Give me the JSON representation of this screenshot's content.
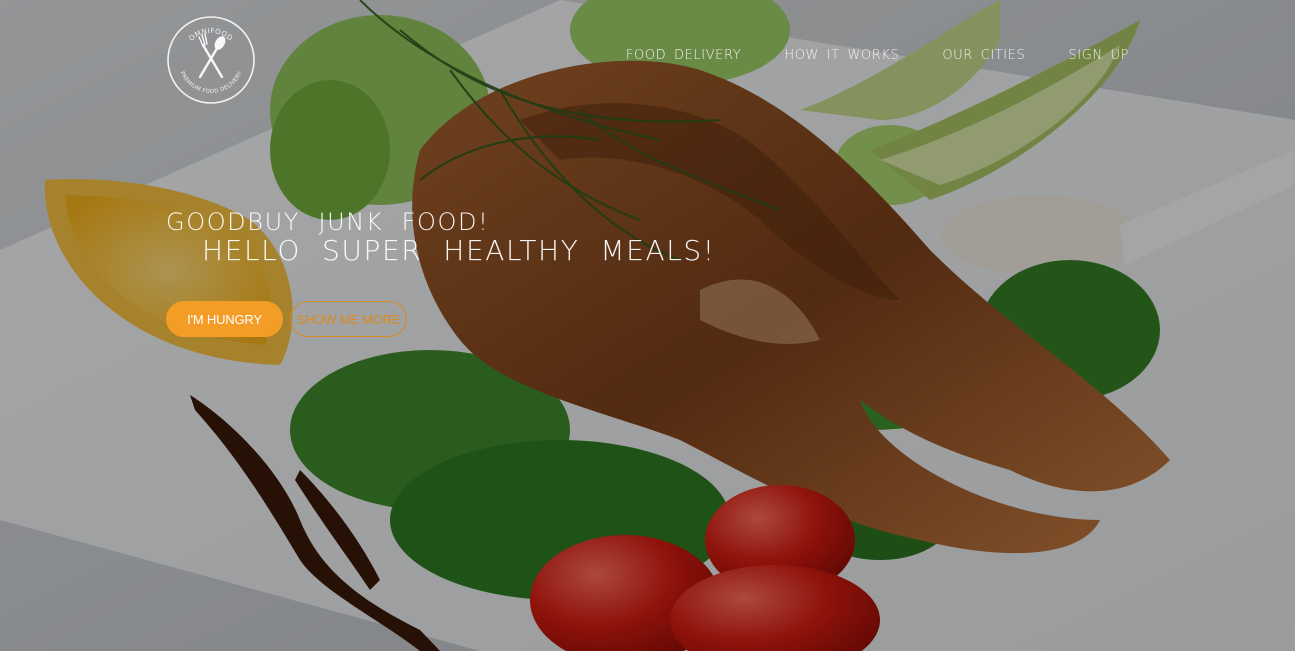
{
  "brand": {
    "logo_top_text": "OMNIFOOD",
    "logo_bottom_text": "PREMIUM FOOD DELIVERY"
  },
  "nav": {
    "items": [
      {
        "label": "FOOD  DELIVERY"
      },
      {
        "label": "HOW  IT  WORKS"
      },
      {
        "label": "OUR  CITIES"
      },
      {
        "label": "SIGN  UP"
      }
    ]
  },
  "hero": {
    "headline_line1": "GOODBUY  JUNK  FOOD!",
    "headline_line2": "HELLO  SUPER  HEALTHY  MEALS!",
    "primary_button": "I'M HUNGRY",
    "secondary_button": "SHOW ME MORE"
  },
  "colors": {
    "accent": "#f39c26",
    "nav_text": "#f2f2f2",
    "overlay": "rgba(0,0,0,0.32)"
  }
}
